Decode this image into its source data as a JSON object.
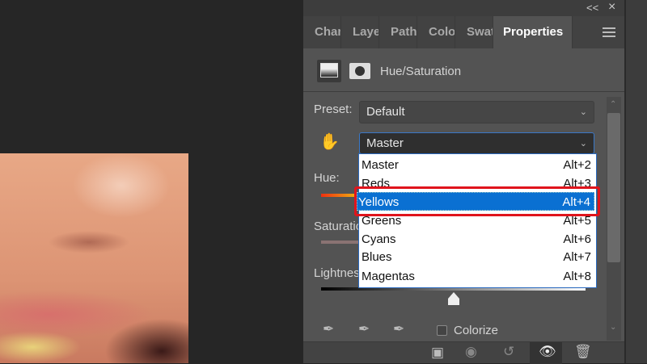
{
  "window": {
    "collapse": "<<",
    "close": "×"
  },
  "tabs": [
    {
      "label": "Chan"
    },
    {
      "label": "Laye"
    },
    {
      "label": "Path"
    },
    {
      "label": "Colo"
    },
    {
      "label": "Swat"
    },
    {
      "label": "Properties"
    }
  ],
  "header": {
    "title": "Hue/Saturation"
  },
  "preset": {
    "label": "Preset:",
    "value": "Default"
  },
  "channel": {
    "value": "Master"
  },
  "channel_options": [
    {
      "label": "Master",
      "shortcut": "Alt+2"
    },
    {
      "label": "Reds",
      "shortcut": "Alt+3"
    },
    {
      "label": "Yellows",
      "shortcut": "Alt+4"
    },
    {
      "label": "Greens",
      "shortcut": "Alt+5"
    },
    {
      "label": "Cyans",
      "shortcut": "Alt+6"
    },
    {
      "label": "Blues",
      "shortcut": "Alt+7"
    },
    {
      "label": "Magentas",
      "shortcut": "Alt+8"
    }
  ],
  "highlighted_option": "Yellows",
  "sliders": {
    "hue": "Hue:",
    "saturation": "Saturation",
    "lightness": "Lightnes",
    "lightness_value_fraction": 0.5
  },
  "colorize": {
    "label": "Colorize",
    "checked": false
  }
}
